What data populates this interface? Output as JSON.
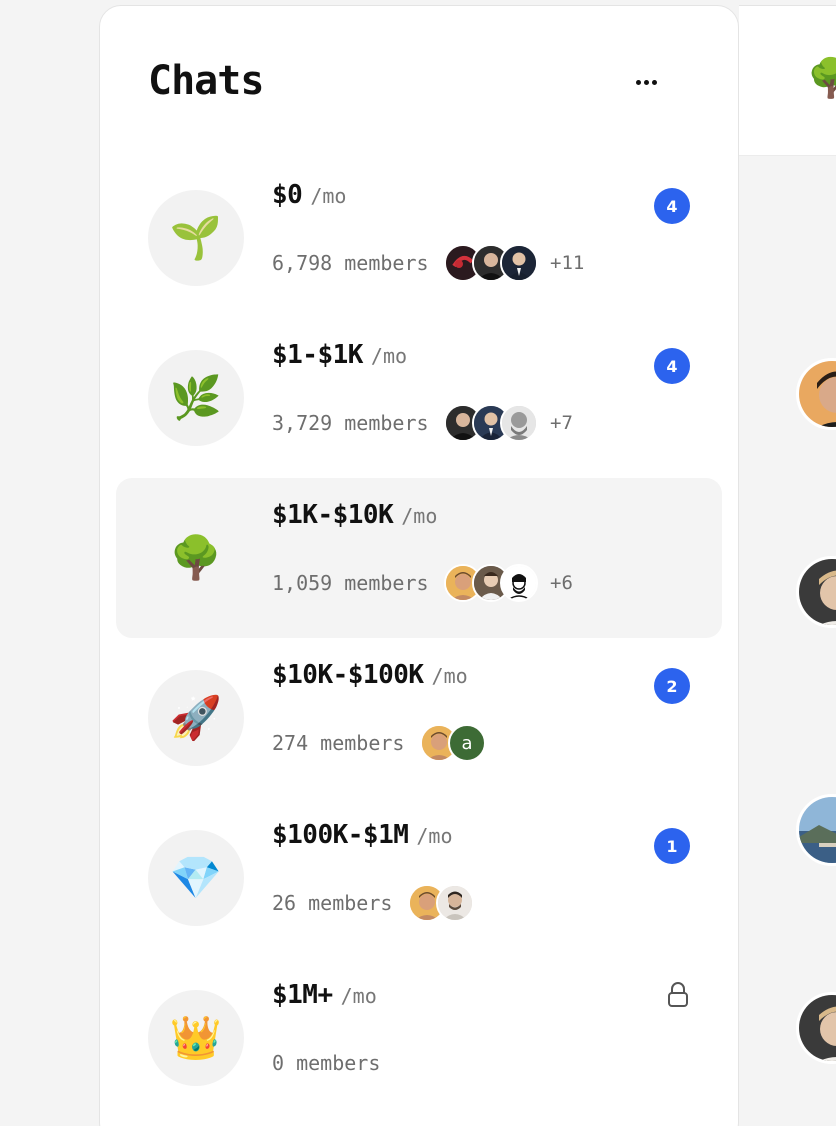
{
  "header": {
    "title": "Chats",
    "more_icon": "more-horizontal-icon"
  },
  "right_panel": {
    "header_icon": "🌳"
  },
  "chats": [
    {
      "emoji": "🌱",
      "name": "$0",
      "unit": "/mo",
      "members": "6,798 members",
      "extra": "+11",
      "badge": "4",
      "locked": false,
      "avatars": [
        "#3a1d24",
        "#2a2a2a",
        "#1f2a3a"
      ]
    },
    {
      "emoji": "🌿",
      "name": "$1-$1K",
      "unit": "/mo",
      "members": "3,729 members",
      "extra": "+7",
      "badge": "4",
      "locked": false,
      "avatars": [
        "#2a2a2a",
        "#26364f",
        "#cfcfcf"
      ]
    },
    {
      "emoji": "🌳",
      "name": "$1K-$10K",
      "unit": "/mo",
      "members": "1,059 members",
      "extra": "+6",
      "badge": "",
      "locked": false,
      "selected": true,
      "avatars": [
        "#e9b45a",
        "#5a4e44",
        "#f5f5f5"
      ]
    },
    {
      "emoji": "🚀",
      "name": "$10K-$100K",
      "unit": "/mo",
      "members": "274 members",
      "extra": "",
      "badge": "2",
      "locked": false,
      "avatars": [
        "#e9b45a",
        "#3d6b35"
      ],
      "letter_avatar": "a"
    },
    {
      "emoji": "💎",
      "name": "$100K-$1M",
      "unit": "/mo",
      "members": "26 members",
      "extra": "",
      "badge": "1",
      "locked": false,
      "avatars": [
        "#e9b45a",
        "#d9d3cc"
      ]
    },
    {
      "emoji": "👑",
      "name": "$1M+",
      "unit": "/mo",
      "members": "0 members",
      "extra": "",
      "badge": "",
      "locked": true,
      "avatars": []
    }
  ],
  "colors": {
    "accent": "#2c63ee",
    "selected_bg": "#f4f4f4",
    "page_bg": "#f4f4f4"
  }
}
